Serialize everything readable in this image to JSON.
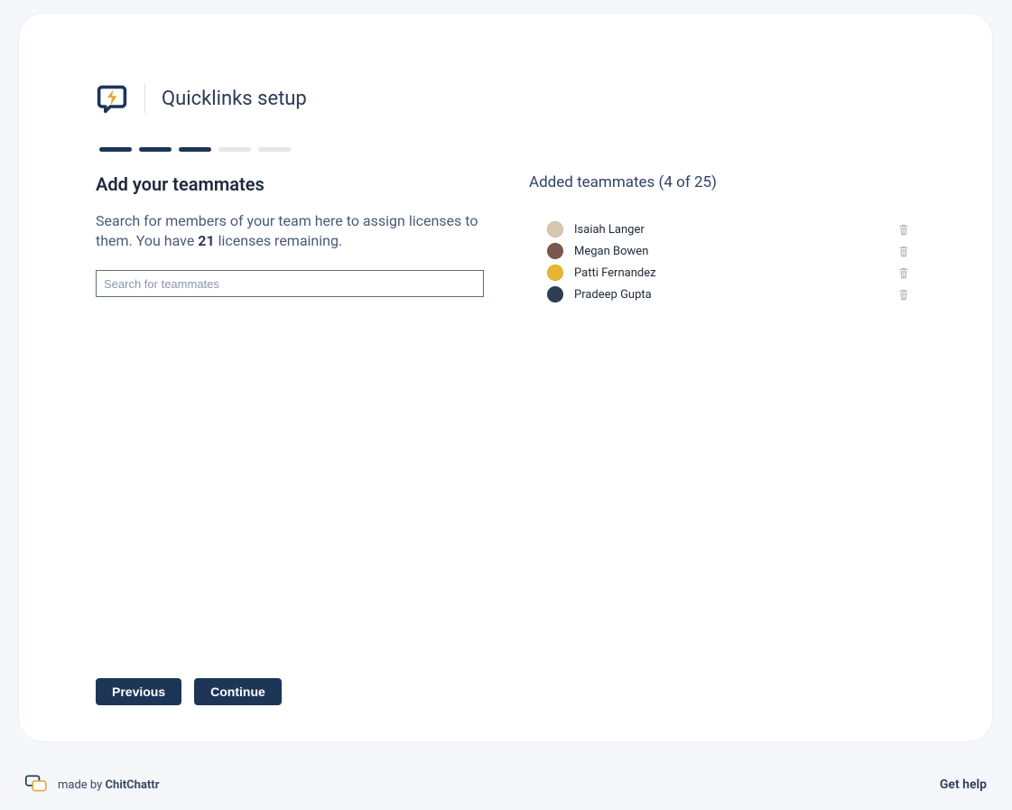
{
  "header": {
    "title": "Quicklinks setup"
  },
  "progress": {
    "total_steps": 5,
    "completed_steps": 3
  },
  "left": {
    "heading": "Add your teammates",
    "description_prefix": "Search for members of your team here to assign licenses to them. You have ",
    "licenses_remaining": "21",
    "description_suffix": " licenses remaining.",
    "search_placeholder": "Search for teammates"
  },
  "right": {
    "added_title": "Added teammates (4 of 25)"
  },
  "teammates": [
    {
      "name": "Isaiah Langer",
      "avatar_bg": "#d7c9b0"
    },
    {
      "name": "Megan Bowen",
      "avatar_bg": "#7a5750"
    },
    {
      "name": "Patti Fernandez",
      "avatar_bg": "#e9b72f"
    },
    {
      "name": "Pradeep Gupta",
      "avatar_bg": "#2f3d54"
    }
  ],
  "buttons": {
    "previous": "Previous",
    "continue": "Continue"
  },
  "footer": {
    "made_by_prefix": "made by ",
    "brand": "ChitChattr",
    "get_help": "Get help"
  }
}
